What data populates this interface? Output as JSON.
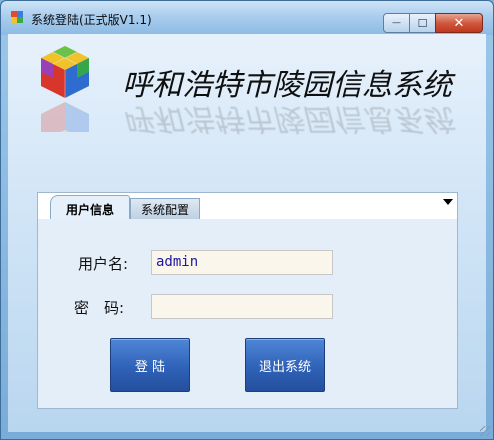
{
  "window": {
    "title": "系统登陆(正式版V1.1)",
    "controls": {
      "minimize": "—",
      "maximize": "☐",
      "close": "✕"
    }
  },
  "header": {
    "app_name": "呼和浩特市陵园信息系统",
    "logo_icon": "color-cube-icon"
  },
  "tabs": [
    {
      "label": "用户信息",
      "active": true
    },
    {
      "label": "系统配置",
      "active": false
    }
  ],
  "form": {
    "username_label": "用户名:",
    "username_value": "admin",
    "password_label": "密　码:",
    "password_value": ""
  },
  "buttons": {
    "login_label": "登 陆",
    "exit_label": "退出系统"
  },
  "colors": {
    "accent": "#2f62b8",
    "input_bg": "#fbf6ec"
  }
}
